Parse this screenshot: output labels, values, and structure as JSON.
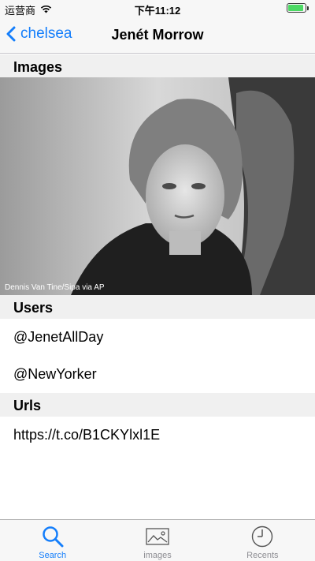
{
  "status_bar": {
    "carrier": "运营商",
    "time": "下午11:12",
    "battery_level": 0.9,
    "battery_color": "#4cd964"
  },
  "nav": {
    "back_label": "chelsea",
    "title": "Jenét Morrow",
    "accent_color": "#147efb"
  },
  "sections": {
    "images_header": "Images",
    "photo_credit": "Dennis Van Tine/Sipa via AP",
    "users_header": "Users",
    "users": [
      "@JenetAllDay",
      "@NewYorker"
    ],
    "urls_header": "Urls",
    "urls": [
      "https://t.co/B1CKYlxl1E"
    ]
  },
  "tabs": [
    {
      "label": "Search",
      "icon": "search-icon",
      "active": true
    },
    {
      "label": "images",
      "icon": "image-icon",
      "active": false
    },
    {
      "label": "Recents",
      "icon": "clock-icon",
      "active": false
    }
  ]
}
